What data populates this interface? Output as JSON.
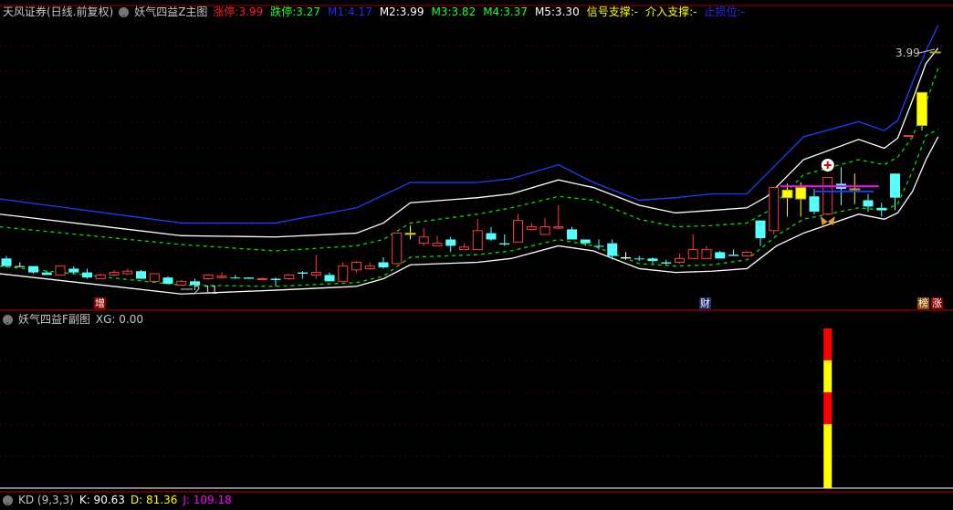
{
  "main_header": {
    "broker": "天风证券(日线.前复权)",
    "indicator": "妖气四益Z主图",
    "fields": [
      {
        "label": "涨停",
        "value": "3.99",
        "color": "#ff2020"
      },
      {
        "label": "跌停",
        "value": "3.27",
        "color": "#20ff20"
      },
      {
        "label": "M1",
        "value": "4.17",
        "color": "#2828ff"
      },
      {
        "label": "M2",
        "value": "3.99",
        "color": "#ffffff"
      },
      {
        "label": "M3",
        "value": "3.82",
        "color": "#20ff20"
      },
      {
        "label": "M4",
        "value": "3.37",
        "color": "#20ff20"
      },
      {
        "label": "M5",
        "value": "3.30",
        "color": "#ffffff"
      },
      {
        "label": "信号支撑",
        "value": "-",
        "color": "#ffff00"
      },
      {
        "label": "介入支撑",
        "value": "-",
        "color": "#ffff00"
      },
      {
        "label": "止损位",
        "value": "-",
        "color": "#2828ff"
      }
    ]
  },
  "sub_header": {
    "indicator": "妖气四益F副图",
    "field": "XG: 0.00"
  },
  "kd_header": {
    "indicator": "KD (9,3,3)",
    "k": "K: 90.63",
    "d": "D: 81.36",
    "j": "J: 109.18"
  },
  "labels": {
    "high": "3.99",
    "low": "2.11",
    "marker_zeng": "增",
    "marker_cai": "财",
    "marker_bang": "榜",
    "marker_zhang": "涨"
  },
  "colors": {
    "up": "#ff3c3c",
    "down": "#54ffff",
    "limit": "#ffff00",
    "grid": "#8b0000",
    "upper_band": "#1e3cff",
    "band": "#ffffff",
    "mid_band": "#00e000",
    "support": "#ff00ff",
    "stop": "#1e3cff"
  },
  "candle_styles": "dxddudduuudududuuddudududuuuduyuuduudduuuuddddxddduuudduduyydudyddduyyyy",
  "candles": [
    [
      2.36,
      2.38,
      2.29,
      2.3
    ],
    [
      2.3,
      2.33,
      2.3,
      2.3
    ],
    [
      2.3,
      2.3,
      2.24,
      2.25
    ],
    [
      2.25,
      2.26,
      2.23,
      2.23
    ],
    [
      2.23,
      2.3,
      2.23,
      2.3
    ],
    [
      2.28,
      2.3,
      2.24,
      2.25
    ],
    [
      2.25,
      2.28,
      2.2,
      2.21
    ],
    [
      2.2,
      2.24,
      2.2,
      2.23
    ],
    [
      2.23,
      2.27,
      2.22,
      2.25
    ],
    [
      2.24,
      2.28,
      2.23,
      2.26
    ],
    [
      2.26,
      2.27,
      2.2,
      2.2
    ],
    [
      2.18,
      2.24,
      2.18,
      2.24
    ],
    [
      2.21,
      2.22,
      2.16,
      2.16
    ],
    [
      2.15,
      2.19,
      2.15,
      2.18
    ],
    [
      2.15,
      2.2,
      2.11,
      2.18
    ],
    [
      2.2,
      2.24,
      2.19,
      2.23
    ],
    [
      2.22,
      2.25,
      2.2,
      2.21
    ],
    [
      2.21,
      2.23,
      2.2,
      2.21
    ],
    [
      2.2,
      2.21,
      2.2,
      2.21
    ],
    [
      2.2,
      2.21,
      2.19,
      2.2
    ],
    [
      2.19,
      2.21,
      2.14,
      2.2
    ],
    [
      2.2,
      2.24,
      2.19,
      2.23
    ],
    [
      2.25,
      2.26,
      2.2,
      2.24
    ],
    [
      2.23,
      2.39,
      2.2,
      2.25
    ],
    [
      2.23,
      2.25,
      2.18,
      2.18
    ],
    [
      2.18,
      2.33,
      2.18,
      2.3
    ],
    [
      2.27,
      2.34,
      2.25,
      2.33
    ],
    [
      2.3,
      2.33,
      2.27,
      2.28
    ],
    [
      2.29,
      2.37,
      2.28,
      2.33
    ],
    [
      2.32,
      2.56,
      2.31,
      2.56
    ],
    [
      2.55,
      2.62,
      2.51,
      2.56
    ],
    [
      2.53,
      2.6,
      2.46,
      2.48
    ],
    [
      2.46,
      2.54,
      2.46,
      2.48
    ],
    [
      2.51,
      2.53,
      2.41,
      2.46
    ],
    [
      2.45,
      2.48,
      2.43,
      2.43
    ],
    [
      2.43,
      2.67,
      2.43,
      2.58
    ],
    [
      2.56,
      2.61,
      2.5,
      2.51
    ],
    [
      2.47,
      2.55,
      2.46,
      2.48
    ],
    [
      2.49,
      2.71,
      2.49,
      2.66
    ],
    [
      2.61,
      2.64,
      2.58,
      2.59
    ],
    [
      2.55,
      2.68,
      2.55,
      2.61
    ],
    [
      2.6,
      2.78,
      2.59,
      2.61
    ],
    [
      2.59,
      2.61,
      2.51,
      2.51
    ],
    [
      2.51,
      2.51,
      2.46,
      2.48
    ],
    [
      2.46,
      2.51,
      2.43,
      2.46
    ],
    [
      2.48,
      2.51,
      2.35,
      2.38
    ],
    [
      2.37,
      2.41,
      2.35,
      2.36
    ],
    [
      2.36,
      2.38,
      2.34,
      2.36
    ],
    [
      2.36,
      2.37,
      2.32,
      2.34
    ],
    [
      2.32,
      2.35,
      2.31,
      2.33
    ],
    [
      2.33,
      2.4,
      2.32,
      2.36
    ],
    [
      2.36,
      2.55,
      2.36,
      2.43
    ],
    [
      2.43,
      2.46,
      2.36,
      2.36
    ],
    [
      2.36,
      2.42,
      2.36,
      2.41
    ],
    [
      2.39,
      2.43,
      2.38,
      2.38
    ],
    [
      2.38,
      2.42,
      2.38,
      2.41
    ],
    [
      2.52,
      2.66,
      2.46,
      2.66
    ],
    [
      2.58,
      2.92,
      2.55,
      2.92
    ],
    [
      2.9,
      2.95,
      2.69,
      2.84
    ],
    [
      2.83,
      2.96,
      2.69,
      2.92
    ],
    [
      2.85,
      2.91,
      2.71,
      2.73
    ],
    [
      2.71,
      3.0,
      2.71,
      3.0
    ],
    [
      2.95,
      3.08,
      2.78,
      2.91
    ],
    [
      2.91,
      3.03,
      2.79,
      2.91
    ],
    [
      2.82,
      2.87,
      2.73,
      2.77
    ],
    [
      2.74,
      2.8,
      2.69,
      2.76
    ],
    [
      2.84,
      3.03,
      2.74,
      3.03
    ],
    [
      3.33,
      3.33,
      3.33,
      3.33
    ],
    [
      3.41,
      3.67,
      3.37,
      3.67
    ],
    [
      3.99,
      3.99,
      3.99,
      3.99
    ]
  ],
  "bands": {
    "upper": [
      [
        -0.5,
        2.83
      ],
      [
        13,
        2.64
      ],
      [
        20,
        2.64
      ],
      [
        26,
        2.76
      ],
      [
        30,
        2.96
      ],
      [
        35,
        2.96
      ],
      [
        37.5,
        2.99
      ],
      [
        41,
        3.1
      ],
      [
        43.6,
        2.96
      ],
      [
        47,
        2.82
      ],
      [
        49.7,
        2.84
      ],
      [
        52.4,
        2.87
      ],
      [
        55,
        2.87
      ],
      [
        56.5,
        3.03
      ],
      [
        59.2,
        3.32
      ],
      [
        63.3,
        3.44
      ],
      [
        65.2,
        3.37
      ],
      [
        66.2,
        3.45
      ],
      [
        67.3,
        3.75
      ],
      [
        68.3,
        4.0
      ],
      [
        69.2,
        4.2
      ]
    ],
    "white_upper": [
      [
        -0.5,
        2.71
      ],
      [
        13,
        2.54
      ],
      [
        20,
        2.53
      ],
      [
        26,
        2.56
      ],
      [
        28,
        2.64
      ],
      [
        30,
        2.8
      ],
      [
        35,
        2.84
      ],
      [
        37.5,
        2.87
      ],
      [
        41,
        2.98
      ],
      [
        43.6,
        2.92
      ],
      [
        47,
        2.78
      ],
      [
        49.7,
        2.72
      ],
      [
        52.4,
        2.74
      ],
      [
        55,
        2.76
      ],
      [
        56.5,
        2.85
      ],
      [
        59.2,
        3.14
      ],
      [
        63.3,
        3.3
      ],
      [
        65.2,
        3.23
      ],
      [
        66.2,
        3.31
      ],
      [
        67.3,
        3.61
      ],
      [
        68.3,
        3.9
      ],
      [
        69.2,
        4.02
      ]
    ],
    "green_upper": [
      [
        -0.5,
        2.61
      ],
      [
        13,
        2.47
      ],
      [
        20,
        2.42
      ],
      [
        26,
        2.46
      ],
      [
        28,
        2.51
      ],
      [
        30,
        2.64
      ],
      [
        35,
        2.71
      ],
      [
        37.5,
        2.76
      ],
      [
        41,
        2.85
      ],
      [
        43.6,
        2.82
      ],
      [
        47,
        2.67
      ],
      [
        49.7,
        2.61
      ],
      [
        52.4,
        2.62
      ],
      [
        55,
        2.64
      ],
      [
        56.5,
        2.73
      ],
      [
        59.2,
        3.02
      ],
      [
        63.3,
        3.14
      ],
      [
        65.2,
        3.1
      ],
      [
        66.2,
        3.16
      ],
      [
        67.3,
        3.32
      ],
      [
        68.3,
        3.59
      ],
      [
        69.2,
        3.86
      ]
    ],
    "green_lower": [
      [
        -0.5,
        2.3
      ],
      [
        13,
        2.15
      ],
      [
        20,
        2.14
      ],
      [
        26,
        2.17
      ],
      [
        28,
        2.22
      ],
      [
        30,
        2.37
      ],
      [
        35,
        2.39
      ],
      [
        37.5,
        2.42
      ],
      [
        41,
        2.51
      ],
      [
        43.6,
        2.46
      ],
      [
        47,
        2.32
      ],
      [
        49.7,
        2.3
      ],
      [
        52.4,
        2.31
      ],
      [
        55,
        2.35
      ],
      [
        57.2,
        2.54
      ],
      [
        59.2,
        2.67
      ],
      [
        63.3,
        2.76
      ],
      [
        65.2,
        2.74
      ],
      [
        66.2,
        2.79
      ],
      [
        67.3,
        3.05
      ],
      [
        68.3,
        3.33
      ],
      [
        69.2,
        3.38
      ]
    ],
    "white_lower": [
      [
        -0.5,
        2.24
      ],
      [
        13,
        2.08
      ],
      [
        20,
        2.11
      ],
      [
        26,
        2.14
      ],
      [
        28,
        2.2
      ],
      [
        30,
        2.31
      ],
      [
        35,
        2.33
      ],
      [
        37.5,
        2.36
      ],
      [
        41,
        2.46
      ],
      [
        43.6,
        2.42
      ],
      [
        47,
        2.28
      ],
      [
        49.7,
        2.25
      ],
      [
        52.4,
        2.26
      ],
      [
        55,
        2.28
      ],
      [
        57.2,
        2.46
      ],
      [
        59.2,
        2.56
      ],
      [
        63.3,
        2.71
      ],
      [
        65.2,
        2.67
      ],
      [
        66.2,
        2.72
      ],
      [
        67.3,
        2.89
      ],
      [
        68.3,
        3.14
      ],
      [
        69.2,
        3.32
      ]
    ]
  },
  "support_line": {
    "price": 2.93,
    "from": 57.5,
    "to": 64.8
  },
  "stop_line": {
    "price": 2.89,
    "from": 60,
    "to": 64.4
  },
  "signal_index": 61,
  "xg_bar": {
    "index": 61,
    "segments": [
      "#ff0000",
      "#ffff00",
      "#ff0000",
      "#ffff00"
    ],
    "segment_fractions": [
      0.2,
      0.2,
      0.2,
      0.4
    ]
  }
}
